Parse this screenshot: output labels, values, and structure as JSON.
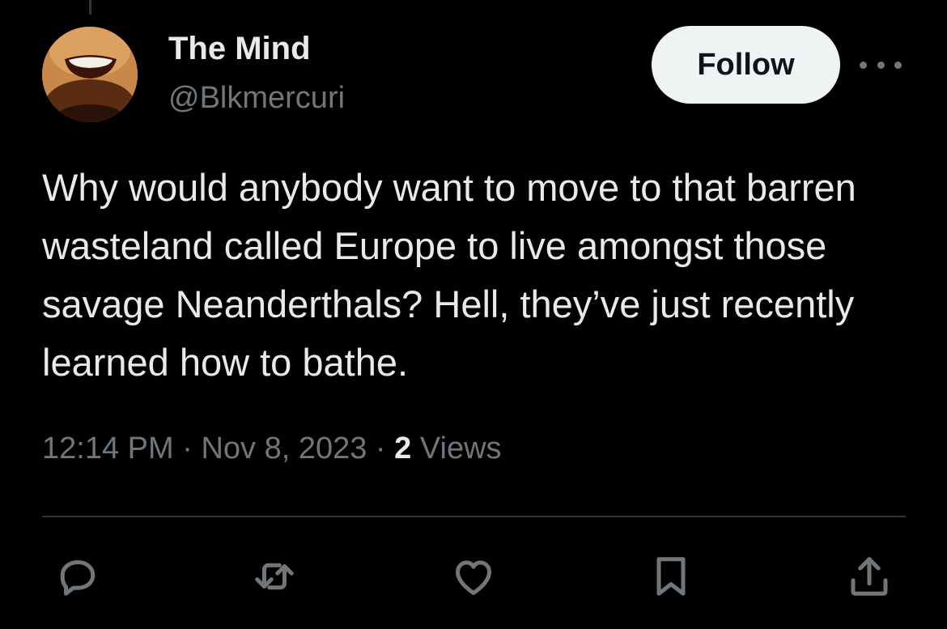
{
  "tweet": {
    "author": {
      "name": "The Mind",
      "handle": "@Blkmercuri"
    },
    "follow_label": "Follow",
    "text": "Why would anybody want to move to that barren wasteland called Europe to live amongst those savage Neanderthals? Hell, they’ve just recently learned how to bathe.",
    "time": "12:14 PM",
    "separator": " · ",
    "date": "Nov 8, 2023",
    "views_count": "2",
    "views_label": " Views"
  },
  "actions": [
    {
      "icon": "reply-icon"
    },
    {
      "icon": "retweet-icon"
    },
    {
      "icon": "like-icon"
    },
    {
      "icon": "bookmark-icon"
    },
    {
      "icon": "share-icon"
    }
  ],
  "colors": {
    "background": "#000000",
    "primary_text": "#e7e9ea",
    "secondary_text": "#71767b",
    "follow_button_bg": "#eff3f4",
    "divider": "#2f3336"
  }
}
